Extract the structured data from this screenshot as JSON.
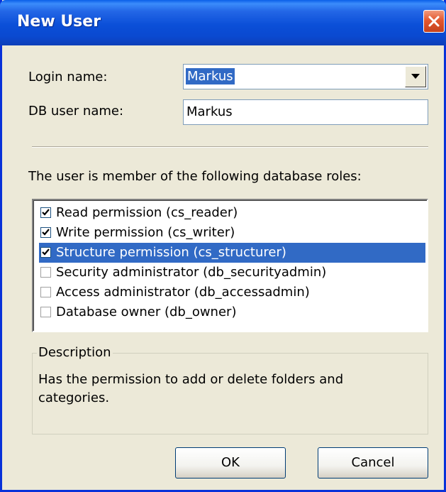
{
  "window": {
    "title": "New User"
  },
  "form": {
    "login_label": "Login name:",
    "login_value": "Markus",
    "db_user_label": "DB user name:",
    "db_user_value": "Markus"
  },
  "roles": {
    "heading": "The user is member of the following database roles:",
    "items": [
      {
        "label": "Read permission (cs_reader)",
        "checked": true,
        "selected": false
      },
      {
        "label": "Write permission (cs_writer)",
        "checked": true,
        "selected": false
      },
      {
        "label": "Structure permission (cs_structurer)",
        "checked": true,
        "selected": true
      },
      {
        "label": "Security administrator  (db_securityadmin)",
        "checked": false,
        "selected": false
      },
      {
        "label": "Access administrator (db_accessadmin)",
        "checked": false,
        "selected": false
      },
      {
        "label": "Database owner (db_owner)",
        "checked": false,
        "selected": false
      }
    ]
  },
  "description": {
    "legend": "Description",
    "text": "Has the permission to add or delete folders and categories."
  },
  "buttons": {
    "ok": "OK",
    "cancel": "Cancel"
  },
  "icons": {
    "close": "close-icon",
    "dropdown": "chevron-down-icon",
    "check": "check-icon"
  },
  "colors": {
    "titlebar": "#0a49d0",
    "selection": "#316ac5",
    "dialog_bg": "#ece9d8"
  }
}
